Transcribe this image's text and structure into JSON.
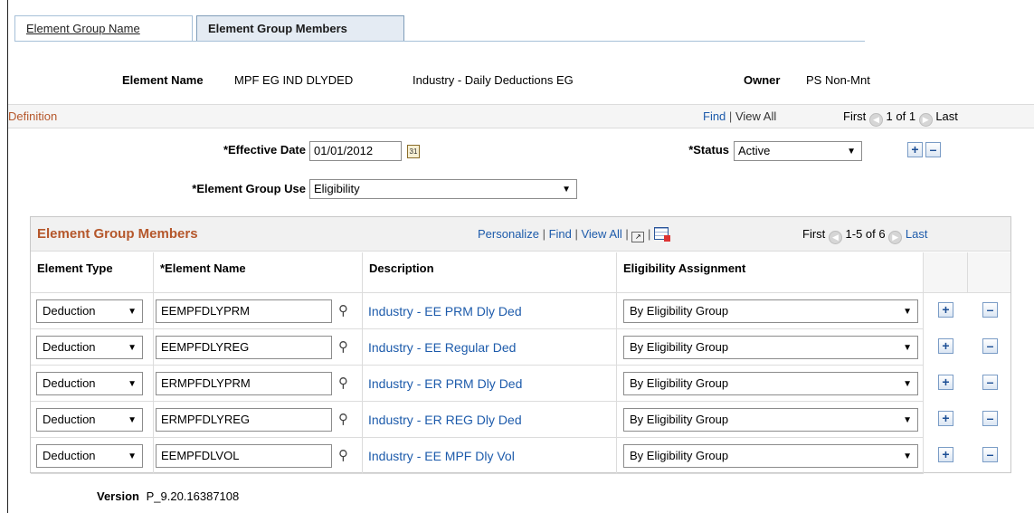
{
  "tabs": [
    {
      "label": "Element Group Name",
      "active": false
    },
    {
      "label": "Element Group Members",
      "active": true
    }
  ],
  "header": {
    "element_name_label": "Element Name",
    "element_name_value": "MPF EG IND DLYDED",
    "element_description": "Industry - Daily Deductions EG",
    "owner_label": "Owner",
    "owner_value": "PS Non-Mnt"
  },
  "definition": {
    "title": "Definition",
    "find": "Find",
    "view_all": "View All",
    "first": "First",
    "count": "1 of 1",
    "last": "Last",
    "effective_date_label": "*Effective Date",
    "effective_date_value": "01/01/2012",
    "status_label": "*Status",
    "status_value": "Active",
    "group_use_label": "*Element Group Use",
    "group_use_value": "Eligibility"
  },
  "grid": {
    "title": "Element Group Members",
    "personalize": "Personalize",
    "find": "Find",
    "view_all": "View All",
    "first": "First",
    "count": "1-5 of 6",
    "last": "Last",
    "columns": [
      "Element Type",
      "*Element Name",
      "Description",
      "Eligibility Assignment"
    ],
    "rows": [
      {
        "type": "Deduction",
        "name": "EEMPFDLYPRM",
        "description": "Industry - EE PRM Dly Ded",
        "assignment": "By Eligibility Group"
      },
      {
        "type": "Deduction",
        "name": "EEMPFDLYREG",
        "description": "Industry - EE Regular Ded",
        "assignment": "By Eligibility Group"
      },
      {
        "type": "Deduction",
        "name": "ERMPFDLYPRM",
        "description": "Industry - ER PRM Dly Ded",
        "assignment": "By Eligibility Group"
      },
      {
        "type": "Deduction",
        "name": "ERMPFDLYREG",
        "description": "Industry - ER REG Dly Ded",
        "assignment": "By Eligibility Group"
      },
      {
        "type": "Deduction",
        "name": "EEMPFDLVOL",
        "description": "Industry - EE MPF Dly Vol",
        "assignment": "By Eligibility Group"
      }
    ]
  },
  "footer": {
    "version_label": "Version",
    "version_value": "P_9.20.16387108"
  },
  "colors": {
    "section_title": "#b5572b",
    "link": "#1d5bab",
    "tab_active_bg": "#e4ebf3"
  }
}
